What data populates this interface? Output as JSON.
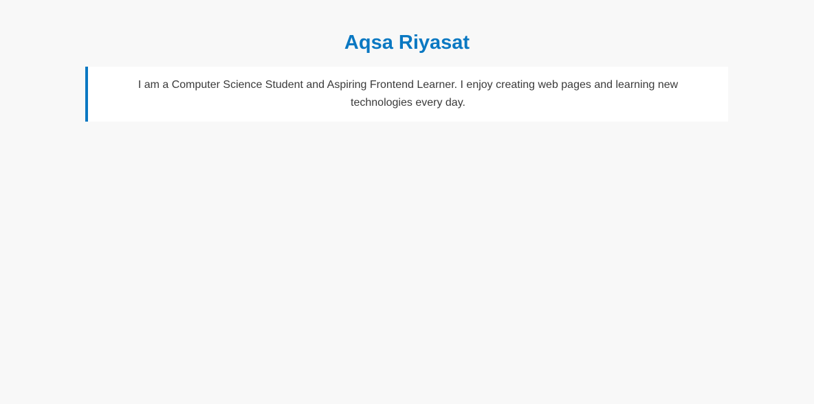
{
  "header": {
    "title": "Aqsa Riyasat"
  },
  "about": {
    "text": "I am a Computer Science Student and Aspiring Frontend Learner. I enjoy creating web pages and learning new technologies every day."
  },
  "colors": {
    "accent": "#0a78c2",
    "background": "#f8f8f8",
    "card": "#ffffff",
    "text": "#3a3a3a"
  }
}
